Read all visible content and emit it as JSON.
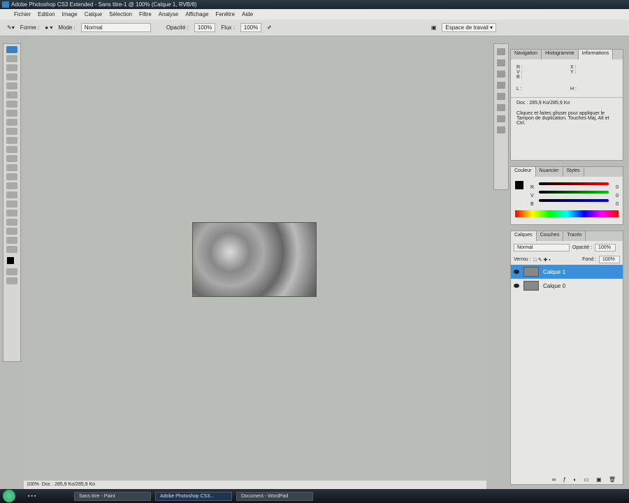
{
  "window": {
    "title": "Adobe Photoshop CS3 Extended - Sans titre-1 @ 100% (Calque 1, RVB/8)"
  },
  "menu": [
    "Fichier",
    "Edition",
    "Image",
    "Calque",
    "Sélection",
    "Filtre",
    "Analyse",
    "Affichage",
    "Fenêtre",
    "Aide"
  ],
  "options": {
    "brush_label": "Forme :",
    "mode_label": "Mode :",
    "mode_value": "Normal",
    "opacity_label": "Opacité :",
    "opacity_value": "100%",
    "flow_label": "Flux :",
    "flow_value": "100%",
    "workspace": "Espace de travail ▾"
  },
  "info_panel": {
    "tabs": [
      "Navigation",
      "Histogramme",
      "Informations"
    ],
    "r": "R :",
    "g": "V :",
    "b": "B :",
    "x": "X :",
    "y": "Y :",
    "w": "L :",
    "h": "H :",
    "doc": "Doc : 285,9 Ko/285,9 Ko",
    "hint": "Cliquez et faites glisser pour appliquer le Tampon de duplication. Touches Maj, Alt et Ctrl."
  },
  "color_panel": {
    "tabs": [
      "Couleur",
      "Nuancier",
      "Styles"
    ],
    "labels": [
      "R",
      "V",
      "B"
    ],
    "values": [
      "0",
      "0",
      "0"
    ]
  },
  "layers_panel": {
    "tabs": [
      "Calques",
      "Couches",
      "Tracés"
    ],
    "blend": "Normal",
    "opacity_label": "Opacité :",
    "opacity": "100%",
    "lock_label": "Verrou :",
    "fill_label": "Fond :",
    "fill": "100%",
    "layers": [
      {
        "name": "Calque 1",
        "selected": true
      },
      {
        "name": "Calque 0",
        "selected": false
      }
    ]
  },
  "status": {
    "zoom": "100%",
    "doc": "Doc : 285,9 Ko/285,9 Ko"
  },
  "taskbar": {
    "items": [
      "Sans titre - Paint",
      "Adobe Photoshop CS3...",
      "Document - WordPad"
    ]
  }
}
